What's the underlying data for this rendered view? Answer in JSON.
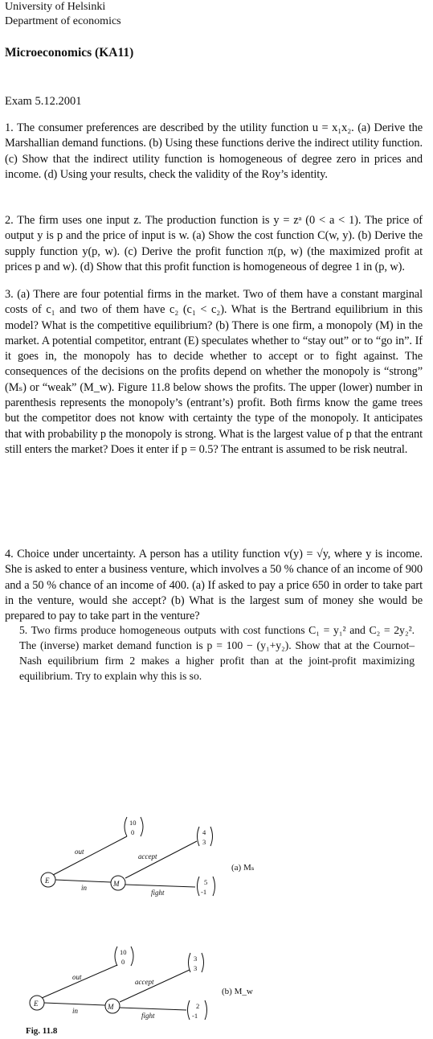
{
  "header": {
    "university": "University of Helsinki",
    "department": "Department of economics",
    "course": "Microeconomics (KA11)",
    "exam": "Exam 5.12.2001"
  },
  "questions": [
    {
      "id": "q1",
      "text": "1. The consumer preferences are described by the utility function u = x₁x₂. (a) Derive the Marshallian demand functions. (b) Using these functions derive the indirect utility function. (c) Show that the indirect utility function is homogeneous of degree zero in prices and income. (d) Using your results, check the validity of the Roy’s identity."
    },
    {
      "id": "q2",
      "text": "2. The firm uses one input z. The production function is y = zᵃ (0 < a < 1). The price of output y is p and the price of input is w. (a) Show the cost function C(w, y). (b) Derive the supply function y(p, w). (c) Derive the profit function π(p, w) (the maximized profit at prices p and w). (d) Show that this profit function is homogeneous of degree 1 in (p, w)."
    },
    {
      "id": "q3",
      "text": "3. (a) There are four potential firms in the market. Two of them have a constant marginal costs of c₁ and two of them have c₂ (c₁ < c₂). What is the Bertrand equilibrium in this model? What is the competitive equilibrium? (b) There is one firm, a monopoly (M) in the market. A potential competitor, entrant (E) speculates whether to “stay out” or to “go in”. If it goes in, the monopoly has to decide whether to accept or to fight against. The consequences of the decisions on the profits depend on whether the monopoly is “strong” (Mₛ) or “weak” (M_w). Figure 11.8 below shows the profits. The upper (lower) number in parenthesis represents the monopoly’s (entrant’s) profit. Both firms know the game trees but the competitor does not know with certainty the type of the monopoly. It anticipates that with probability p the monopoly is strong. What is the largest value of p that the entrant still enters the market? Does it enter if p = 0.5? The entrant is assumed to be risk neutral."
    },
    {
      "id": "q4",
      "text": "4. Choice under uncertainty. A person has a utility function v(y) = √y, where y is income. She is asked to enter a business venture, which involves a 50 % chance of an income of 900 and a 50 % chance of an income of 400. (a) If asked to pay a price 650 in order to take part in the venture, would she accept? (b) What is the largest sum of money she would be prepared to pay to take part in the venture?"
    },
    {
      "id": "q5",
      "text": "5. Two firms produce homogeneous outputs with cost functions C₁ = y₁² and C₂ = 2y₂². The (inverse) market demand function is p = 100 − (y₁+y₂). Show that at the Cournot–Nash equilibrium firm 2 makes a higher profit than at the joint-profit maximizing equilibrium. Try to explain why this is so."
    }
  ],
  "figure": {
    "caption": "Fig. 11.8",
    "tree_a": {
      "label": "(a) Mₛ",
      "node_e": "E",
      "node_m": "M",
      "branch_out": "out",
      "branch_in": "in",
      "branch_accept": "accept",
      "branch_fight": "fight",
      "payoff_out": [
        "10",
        "0"
      ],
      "payoff_accept": [
        "4",
        "3"
      ],
      "payoff_fight": [
        "5",
        "-1"
      ]
    },
    "tree_b": {
      "label": "(b) M_w",
      "node_e": "E",
      "node_m": "M",
      "branch_out": "out",
      "branch_in": "in",
      "branch_accept": "accept",
      "branch_fight": "fight",
      "payoff_out": [
        "10",
        "0"
      ],
      "payoff_accept": [
        "3",
        "3"
      ],
      "payoff_fight": [
        "2",
        "-1"
      ]
    }
  }
}
